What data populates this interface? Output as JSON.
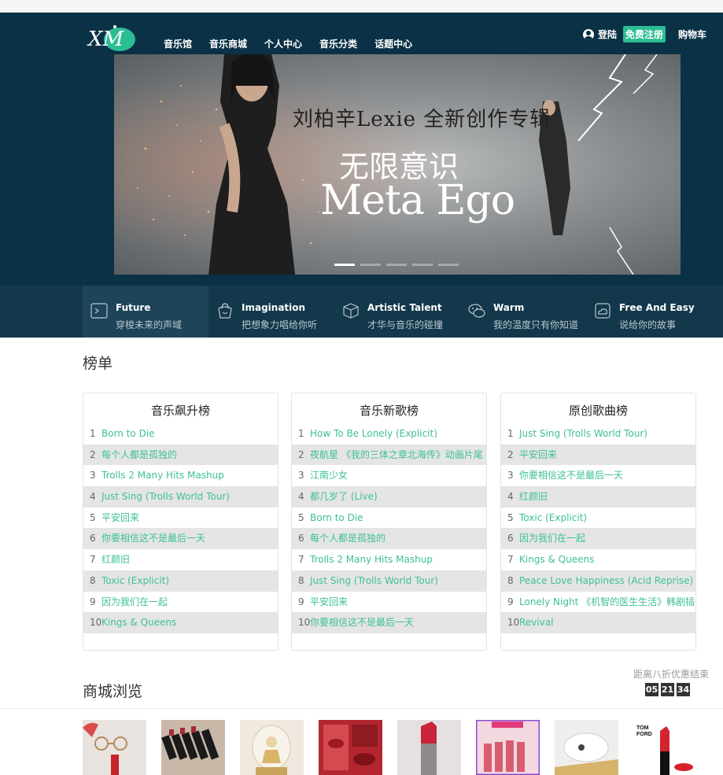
{
  "nav": {
    "items": [
      "音乐馆",
      "音乐商城",
      "个人中心",
      "音乐分类",
      "话题中心"
    ]
  },
  "userbar": {
    "login": "登陆",
    "register": "免费注册",
    "cart": "购物车"
  },
  "banner": {
    "subtitle": "刘柏辛Lexie 全新创作专辑",
    "title": "无限意识",
    "title_en": "Meta Ego",
    "slides": 5,
    "active_slide": 1
  },
  "features": [
    {
      "title": "Future",
      "subtitle": "穿梭未来的声域",
      "icon": "terminal-icon"
    },
    {
      "title": "Imagination",
      "subtitle": "把想象力唱给你听",
      "icon": "bag-icon"
    },
    {
      "title": "Artistic Talent",
      "subtitle": "才华与音乐的碰撞",
      "icon": "cube-icon"
    },
    {
      "title": "Warm",
      "subtitle": "我的温度只有你知道",
      "icon": "chat-icon"
    },
    {
      "title": "Free And Easy",
      "subtitle": "说给你的故事",
      "icon": "cloud-icon"
    }
  ],
  "charts_section": {
    "title": "榜单",
    "charts": [
      {
        "title": "音乐飙升榜",
        "songs": [
          "Born to Die",
          "每个人都是孤独的",
          "Trolls 2 Many Hits Mashup",
          "Just Sing (Trolls World Tour)",
          "平安回来",
          "你要相信这不是最后一天",
          "红颜旧",
          "Toxic (Explicit)",
          "因为我们在一起",
          "Kings & Queens"
        ]
      },
      {
        "title": "音乐新歌榜",
        "songs": [
          "How To Be Lonely (Explicit)",
          "夜航星 《我的三体之章北海传》动画片尾",
          "江南少女",
          "都几岁了 (Live)",
          "Born to Die",
          "每个人都是孤独的",
          "Trolls 2 Many Hits Mashup",
          "Just Sing (Trolls World Tour)",
          "平安回来",
          "你要相信这不是最后一天"
        ]
      },
      {
        "title": "原创歌曲榜",
        "songs": [
          "Just Sing (Trolls World Tour)",
          "平安回来",
          "你要相信这不是最后一天",
          "红颜旧",
          "Toxic (Explicit)",
          "因为我们在一起",
          "Kings & Queens",
          "Peace Love Happiness (Acid Reprise)",
          "Lonely Night 《机智的医生生活》韩剧插曲",
          "Revival"
        ]
      }
    ]
  },
  "shop": {
    "title": "商城浏览",
    "countdown_label": "距离八折优惠结束",
    "countdown": [
      "05",
      "21",
      "34"
    ],
    "products": [
      "glasses-and-lipstick",
      "lipstick-set",
      "music-box",
      "lipstick-magazine",
      "red-lipstick",
      "colourpop-box",
      "white-compact",
      "tom-ford-lipstick"
    ]
  },
  "colors": {
    "header_bg": "#0a3145",
    "feature_bg": "#13384b",
    "accent_green": "#2bbd94",
    "song_green": "#3ec096"
  }
}
